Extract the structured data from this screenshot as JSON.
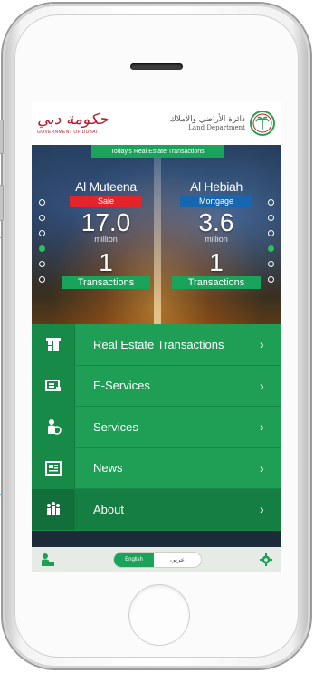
{
  "header": {
    "gov_logo_script": "حكومة دبي",
    "gov_logo_sub": "GOVERNMENT OF DUBAI",
    "ldd_arabic": "دائرة الأراضي والأملاك",
    "ldd_english": "Land Department"
  },
  "hero": {
    "banner": "Today's Real Estate Transactions",
    "panels": [
      {
        "area": "Al Muteena",
        "type": "Sale",
        "value": "17.0",
        "unit": "million",
        "count": "1",
        "count_label": "Transactions"
      },
      {
        "area": "Al Hebiah",
        "type": "Mortgage",
        "value": "3.6",
        "unit": "million",
        "count": "1",
        "count_label": "Transactions"
      }
    ]
  },
  "menu": {
    "items": [
      {
        "label": "Real Estate Transactions",
        "icon": "transactions-icon"
      },
      {
        "label": "E-Services",
        "icon": "eservices-icon"
      },
      {
        "label": "Services",
        "icon": "services-icon"
      },
      {
        "label": "News",
        "icon": "news-icon"
      },
      {
        "label": "About",
        "icon": "about-icon"
      }
    ],
    "chevron": "›"
  },
  "bottom": {
    "lang_en": "English",
    "lang_ar": "عربي",
    "home_icon": "home-person-icon",
    "settings_icon": "gear-icon"
  },
  "colors": {
    "accent_green": "#1aa35a",
    "sale_red": "#e3242b",
    "mortgage_blue": "#1766b0",
    "brand_red": "#b5202f"
  }
}
